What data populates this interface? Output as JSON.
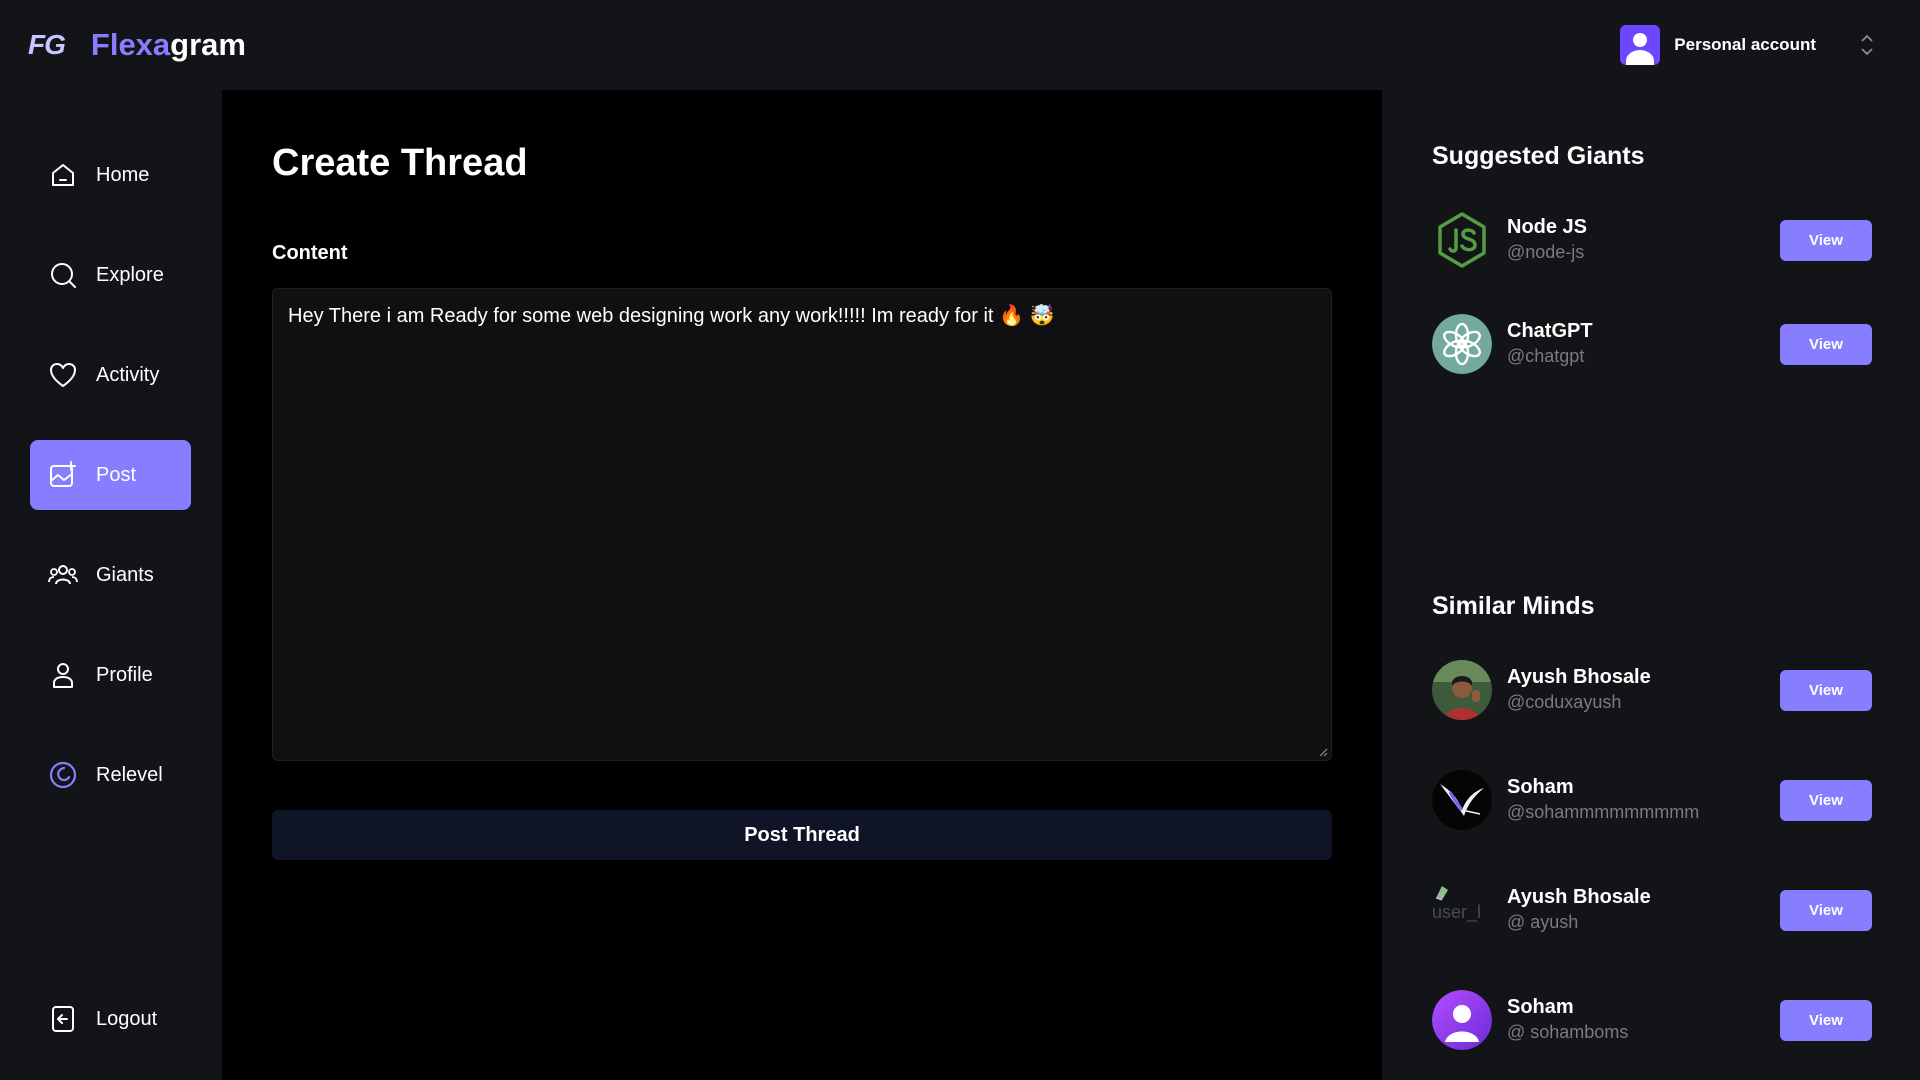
{
  "app": {
    "logo_mark": "FG",
    "name_accent": "Flexa",
    "name_rest": "gram"
  },
  "account": {
    "label": "Personal account",
    "avatar_icon": "user-avatar-icon",
    "chevron_icon": "chevron-up-down-icon",
    "avatar_color": "#6c47ff"
  },
  "sidebar": {
    "items": [
      {
        "label": "Home",
        "icon": "home-icon",
        "active": false
      },
      {
        "label": "Explore",
        "icon": "search-icon",
        "active": false
      },
      {
        "label": "Activity",
        "icon": "heart-icon",
        "active": false
      },
      {
        "label": "Post",
        "icon": "post-image-icon",
        "active": true
      },
      {
        "label": "Giants",
        "icon": "people-icon",
        "active": false
      },
      {
        "label": "Profile",
        "icon": "user-icon",
        "active": false
      },
      {
        "label": "Relevel",
        "icon": "relevel-icon",
        "active": false
      }
    ],
    "logout_label": "Logout",
    "logout_icon": "logout-icon"
  },
  "main": {
    "title": "Create Thread",
    "content_label": "Content",
    "content_value": "Hey There i am Ready for some web designing work any work!!!!! Im ready for it 🔥 🤯",
    "submit_label": "Post Thread"
  },
  "right": {
    "suggested_title": "Suggested Giants",
    "suggested": [
      {
        "name": "Node JS",
        "handle": "@node-js",
        "avatar": "nodejs-logo-icon",
        "button": "View"
      },
      {
        "name": "ChatGPT",
        "handle": "@chatgpt",
        "avatar": "chatgpt-logo-icon",
        "button": "View"
      }
    ],
    "similar_title": "Similar Minds",
    "similar": [
      {
        "name": "Ayush Bhosale",
        "handle": "@coduxayush",
        "avatar": "photo-avatar",
        "button": "View"
      },
      {
        "name": "Soham",
        "handle": "@sohammmmmmmmm",
        "avatar": "bird-avatar",
        "button": "View"
      },
      {
        "name": "Ayush Bhosale",
        "handle": "@ ayush",
        "avatar": "broken-image-avatar",
        "avatar_alt": "user_l",
        "button": "View"
      },
      {
        "name": "Soham",
        "handle": "@ sohamboms",
        "avatar": "default-user-avatar",
        "button": "View"
      }
    ]
  },
  "colors": {
    "accent": "#877eff",
    "panel_bg": "#121417",
    "main_bg": "#000000",
    "button_dark": "#0f1527",
    "handle_gray": "#7a7a80"
  }
}
